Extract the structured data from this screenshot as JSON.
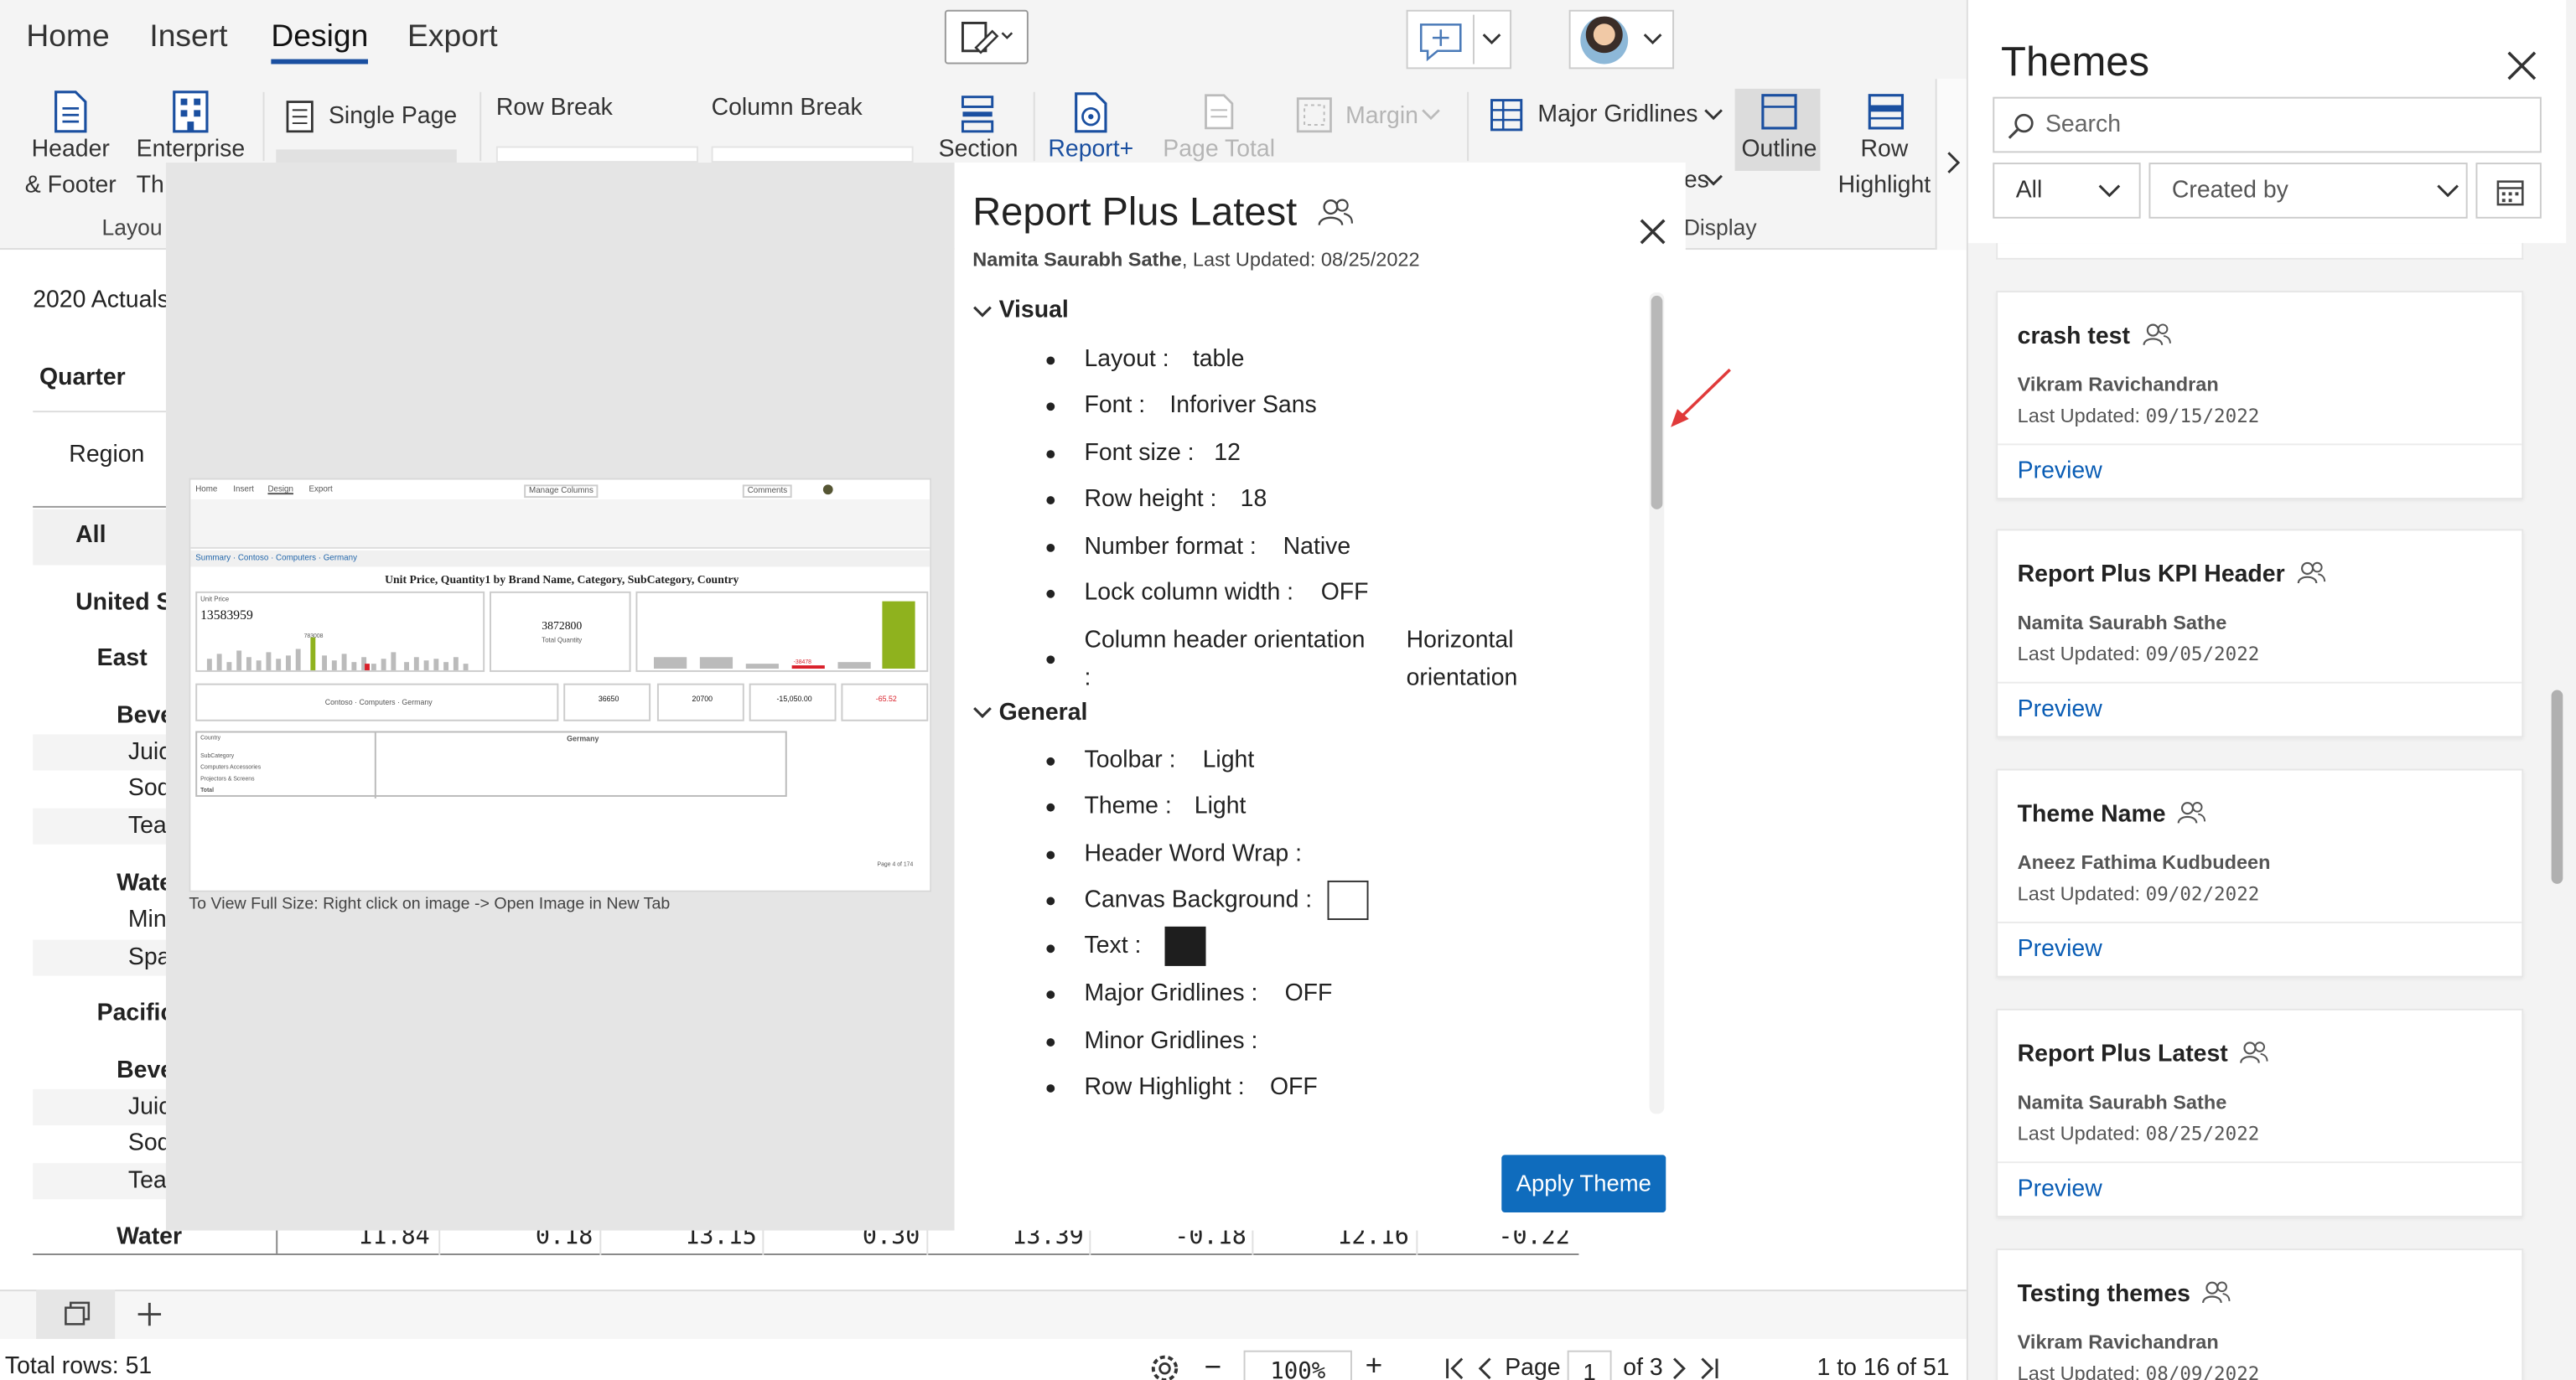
{
  "ribbon": {
    "tabs": [
      "Home",
      "Insert",
      "Design",
      "Export"
    ],
    "active_tab": "Design",
    "header_footer_1": "Header",
    "header_footer_2": "& Footer",
    "enterprise_1": "Enterprise",
    "enterprise_2": "Th",
    "single_page": "Single Page",
    "row_break": "Row Break",
    "column_break": "Column Break",
    "section": "Section",
    "report_plus": "Report+",
    "page_total": "Page Total",
    "margin": "Margin",
    "major_gridlines": "Major Gridlines",
    "es_fragment": "es",
    "outline": "Outline",
    "row_highlight_1": "Row",
    "row_highlight_2": "Highlight",
    "group_layout": "Layou",
    "group_display": "Display"
  },
  "grid": {
    "title": "2020 Actuals",
    "quarter": "Quarter",
    "region": "Region",
    "all": "All",
    "united": "United St",
    "east": "East",
    "beve1": "Beve",
    "juic1": "Juic",
    "sod1": "Sod",
    "tea1": "Tea",
    "wate": "Wate",
    "min": "Min",
    "spa": "Spa",
    "pacific": "Pacific",
    "beve2": "Beve",
    "juic2": "Juic",
    "sod2": "Sod",
    "tea2": "Tea",
    "water": "Water",
    "water_values": [
      "11.84",
      "0.18",
      "13.15",
      "0.30",
      "13.39",
      "-0.18",
      "12.16",
      "-0.22"
    ]
  },
  "footer": {
    "total_rows": "Total rows: 51",
    "zoom": "100%",
    "page_label": "Page",
    "page_value": "1",
    "page_of": "of 3",
    "range": "1 to 16 of 51"
  },
  "preview": {
    "hint": "To View Full Size: Right click on image -> Open Image in New Tab",
    "mini": {
      "tabs": [
        "Home",
        "Insert",
        "Design",
        "Export"
      ],
      "manage": "Manage Columns",
      "comments": "Comments",
      "breadcrumb": "Summary · Contoso · Computers · Germany",
      "title": "Unit Price, Quantity1 by Brand Name, Category, SubCategory, Country",
      "kpi1_label": "Unit Price",
      "kpi1_value": "13583959",
      "kpi2_value": "3872800",
      "kpi2_label": "Total Quantity",
      "bar_label": "783008",
      "neg_label": "-38478",
      "kpi_strip": "Contoso · Computers · Germany",
      "chip1": "36650",
      "chip2": "20700",
      "chip3": "-15,050.00",
      "chip4": "-65.52",
      "table_country": "Germany",
      "table_col0": "Country",
      "row1": "SubCategory",
      "row2": "Computers Accessories",
      "row3": "Projectors & Screens",
      "row4": "Total",
      "pager": "Page 4 of 174"
    }
  },
  "theme_detail": {
    "title": "Report Plus Latest",
    "author": "Namita Saurabh Sathe",
    "updated": ", Last Updated: 08/25/2022",
    "visual_header": "Visual",
    "general_header": "General",
    "visual_props": [
      {
        "k": "Layout :",
        "v": "table"
      },
      {
        "k": "Font :",
        "v": "Inforiver Sans"
      },
      {
        "k": "Font size :",
        "v": "12"
      },
      {
        "k": "Row height :",
        "v": "18"
      },
      {
        "k": "Number format :",
        "v": "Native"
      },
      {
        "k": "Lock column width :",
        "v": "OFF"
      }
    ],
    "orientation_key": "Column header orientation",
    "orientation_colon": ":",
    "orientation_value_1": "Horizontal",
    "orientation_value_2": "orientation",
    "general_props": [
      {
        "k": "Toolbar :",
        "v": "Light"
      },
      {
        "k": "Theme :",
        "v": "Light"
      },
      {
        "k": "Header Word Wrap :",
        "v": ""
      },
      {
        "k": "Canvas Background :",
        "v": ""
      },
      {
        "k": "Text :",
        "v": ""
      },
      {
        "k": "Major Gridlines :",
        "v": "OFF"
      },
      {
        "k": "Minor Gridlines :",
        "v": ""
      },
      {
        "k": "Row Highlight :",
        "v": "OFF"
      }
    ],
    "apply_label": "Apply Theme"
  },
  "themes_panel": {
    "title": "Themes",
    "search_placeholder": "Search",
    "filter_all": "All",
    "filter_created": "Created by",
    "preview_label": "Preview",
    "cards": [
      {
        "name": "crash test",
        "author": "Vikram Ravichandran",
        "updated_label": "Last Updated: ",
        "updated": "09/15/2022"
      },
      {
        "name": "Report Plus KPI Header",
        "author": "Namita Saurabh Sathe",
        "updated_label": "Last Updated: ",
        "updated": "09/05/2022"
      },
      {
        "name": "Theme Name",
        "author": "Aneez Fathima Kudbudeen",
        "updated_label": "Last Updated: ",
        "updated": "09/02/2022"
      },
      {
        "name": "Report Plus Latest",
        "author": "Namita Saurabh Sathe",
        "updated_label": "Last Updated: ",
        "updated": "08/25/2022"
      },
      {
        "name": "Testing themes",
        "author": "Vikram Ravichandran",
        "updated_label": "Last Updated: ",
        "updated": "08/09/2022"
      }
    ]
  },
  "colors": {
    "accent": "#0a5db5",
    "apply_button": "#0f6cbd",
    "annotation_arrow": "#e03a3a",
    "chart_green": "#8fb21e",
    "chart_red": "#d9202a"
  },
  "icons": [
    "file-icon",
    "enterprise-themes-icon",
    "single-page-icon",
    "section-icon",
    "report-plus-icon",
    "page-total-icon",
    "margin-icon",
    "gridlines-icon",
    "outline-icon",
    "row-highlight-icon",
    "comment-icon",
    "chevron-down-icon",
    "avatar",
    "close-icon",
    "search-icon",
    "calendar-icon",
    "shared-users-icon",
    "settings-icon",
    "first-page-icon",
    "prev-page-icon",
    "next-page-icon",
    "last-page-icon",
    "add-page-icon",
    "pages-icon"
  ]
}
